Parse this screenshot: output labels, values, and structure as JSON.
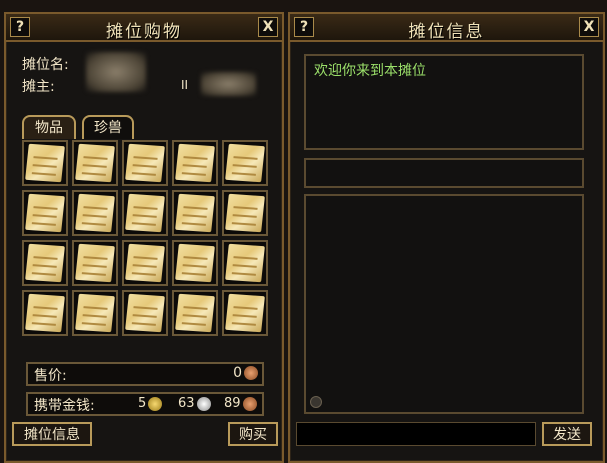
{
  "stall_shop": {
    "title": "摊位购物",
    "help_label": "?",
    "close_label": "X",
    "stall_name_label": "摊位名:",
    "owner_label": "摊主:",
    "owner_suffix": "II",
    "tabs": [
      {
        "label": "物品"
      },
      {
        "label": "珍兽"
      }
    ],
    "item_icon": "scroll-icon",
    "price_label": "售价:",
    "price_value": "0",
    "carry_money_label": "携带金钱:",
    "money": {
      "gold": "5",
      "silver": "63",
      "copper": "89"
    },
    "stall_info_button": "摊位信息",
    "buy_button": "购买"
  },
  "stall_info": {
    "title": "摊位信息",
    "help_label": "?",
    "close_label": "X",
    "welcome_message": "欢迎你来到本摊位",
    "send_button": "发送"
  },
  "colors": {
    "gold": "#d8b040",
    "silver": "#c8c8c8",
    "copper": "#b06a3a",
    "frame": "#7a5a2c",
    "message_text": "#9be06a"
  }
}
